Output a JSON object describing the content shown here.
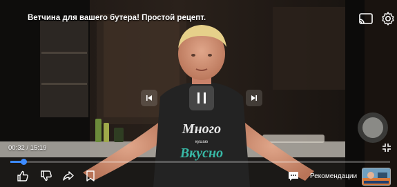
{
  "video": {
    "title": "Ветчина для вашего бутера! Простой рецепт.",
    "current_time": "00:32",
    "duration": "15:19",
    "time_display": "00:32 / 15:19",
    "progress_fraction": 0.035,
    "shirt_print": [
      "Много",
      "кушаю",
      "Вкусно"
    ]
  },
  "controls": {
    "recommendations_label": "Рекомендации"
  },
  "icons": {
    "cast": "cast-icon",
    "settings": "gear-icon",
    "previous": "skip-previous-icon",
    "pause": "pause-icon",
    "next": "skip-next-icon",
    "fullscreen": "fullscreen-icon",
    "like": "thumb-up-icon",
    "dislike": "thumb-down-icon",
    "share": "share-icon",
    "save": "bookmark-icon",
    "comments": "comment-icon"
  },
  "colors": {
    "accent": "#3d8bff",
    "text": "#ffffff"
  }
}
